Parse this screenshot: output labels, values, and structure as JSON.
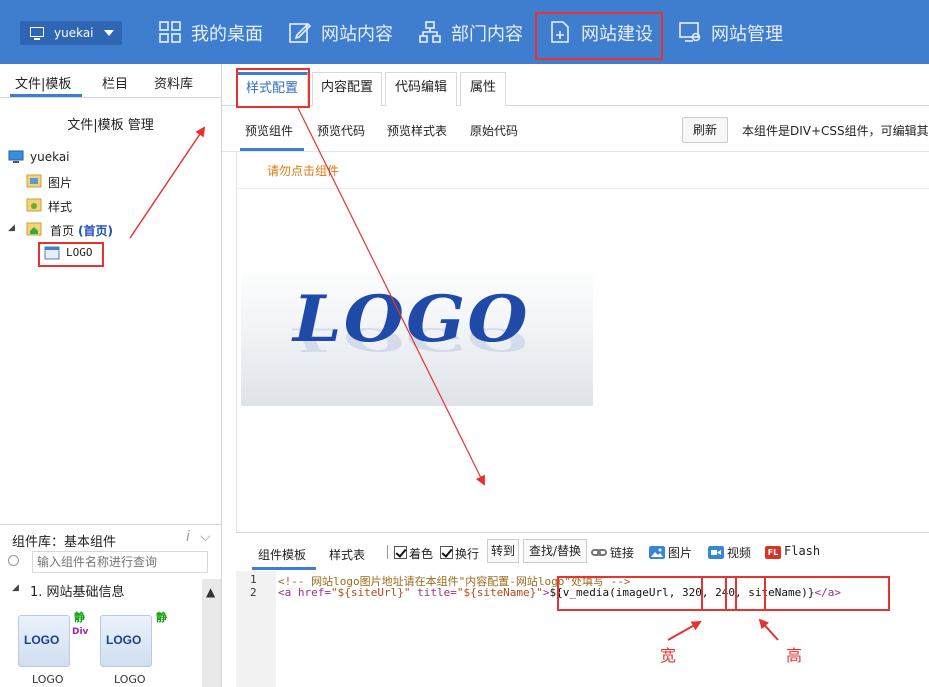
{
  "topbar": {
    "site_name": "yuekai",
    "nav": [
      {
        "label": "我的桌面",
        "icon": "grid-icon"
      },
      {
        "label": "网站内容",
        "icon": "edit-icon"
      },
      {
        "label": "部门内容",
        "icon": "org-chart-icon"
      },
      {
        "label": "网站建设",
        "icon": "add-page-icon",
        "active": true
      },
      {
        "label": "网站管理",
        "icon": "monitor-settings-icon"
      }
    ]
  },
  "left": {
    "tabs": [
      "文件|模板",
      "栏目",
      "资料库"
    ],
    "manage_link": "文件|模板 管理",
    "tree": {
      "root": "yuekai",
      "folder_images": "图片",
      "folder_styles": "样式",
      "home_label": "首页",
      "home_suffix": "(首页)",
      "logo_item": "LOGO"
    },
    "complib": {
      "label": "组件库：基本组件",
      "search_placeholder": "输入组件名称进行查询",
      "group": "1. 网站基础信息",
      "cards": [
        {
          "name": "LOGO",
          "badge": "静",
          "sub": "Div"
        },
        {
          "name": "LOGO",
          "badge": "静",
          "sub": ""
        }
      ]
    }
  },
  "main": {
    "tabs": [
      "样式配置",
      "内容配置",
      "代码编辑",
      "属性"
    ],
    "subtabs": [
      "预览组件",
      "预览代码",
      "预览样式表",
      "原始代码"
    ],
    "refresh": "刷新",
    "description": "本组件是DIV+CSS组件，可编辑其",
    "preview_warning": "请勿点击组件",
    "logo_text": "LOGO",
    "editor": {
      "tabs": [
        "组件模板",
        "样式表"
      ],
      "checks": [
        "着色",
        "换行"
      ],
      "buttons": [
        "转到",
        "查找/替换"
      ],
      "inserts": [
        "链接",
        "图片",
        "视频",
        "Flash"
      ],
      "flash_icon_text": "FL",
      "line_numbers": [
        "1",
        "2"
      ],
      "line1": "<!-- 网站logo图片地址请在本组件\"内容配置-网站logo\"处填写 -->",
      "line2_parts": {
        "open_tag": "<a href=",
        "href": "\"${siteUrl}\"",
        "title_attr": " title=",
        "title_val": "\"${siteName}\"",
        "close_gt": ">",
        "expr": "${v_media(imageUrl, 320, 240, siteName)}",
        "end_tag": "</a>"
      }
    }
  },
  "annotations": {
    "width_label": "宽",
    "height_label": "高"
  },
  "colors": {
    "topbar": "#3f7ecf",
    "accent": "#3f7ecf",
    "annotation": "#e8322f",
    "warning": "#e07a10"
  }
}
